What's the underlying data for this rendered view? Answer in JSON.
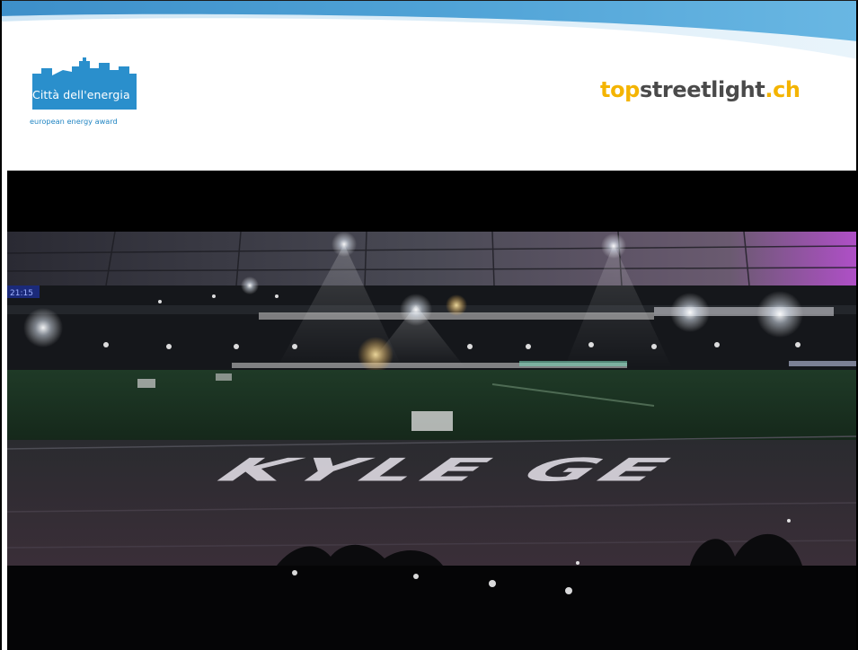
{
  "logo_left": {
    "title": "Città dell'energia",
    "subtitle": "european energy award",
    "color": "#2a8fcc"
  },
  "brand_right": {
    "part_top": "top",
    "part_mid": "streetlight",
    "part_ch": ".ch",
    "accent_color": "#f4b400",
    "text_color": "#4a4a4a"
  },
  "video": {
    "field_text": "KYLE GE",
    "scoreboard_text": "21:15"
  }
}
